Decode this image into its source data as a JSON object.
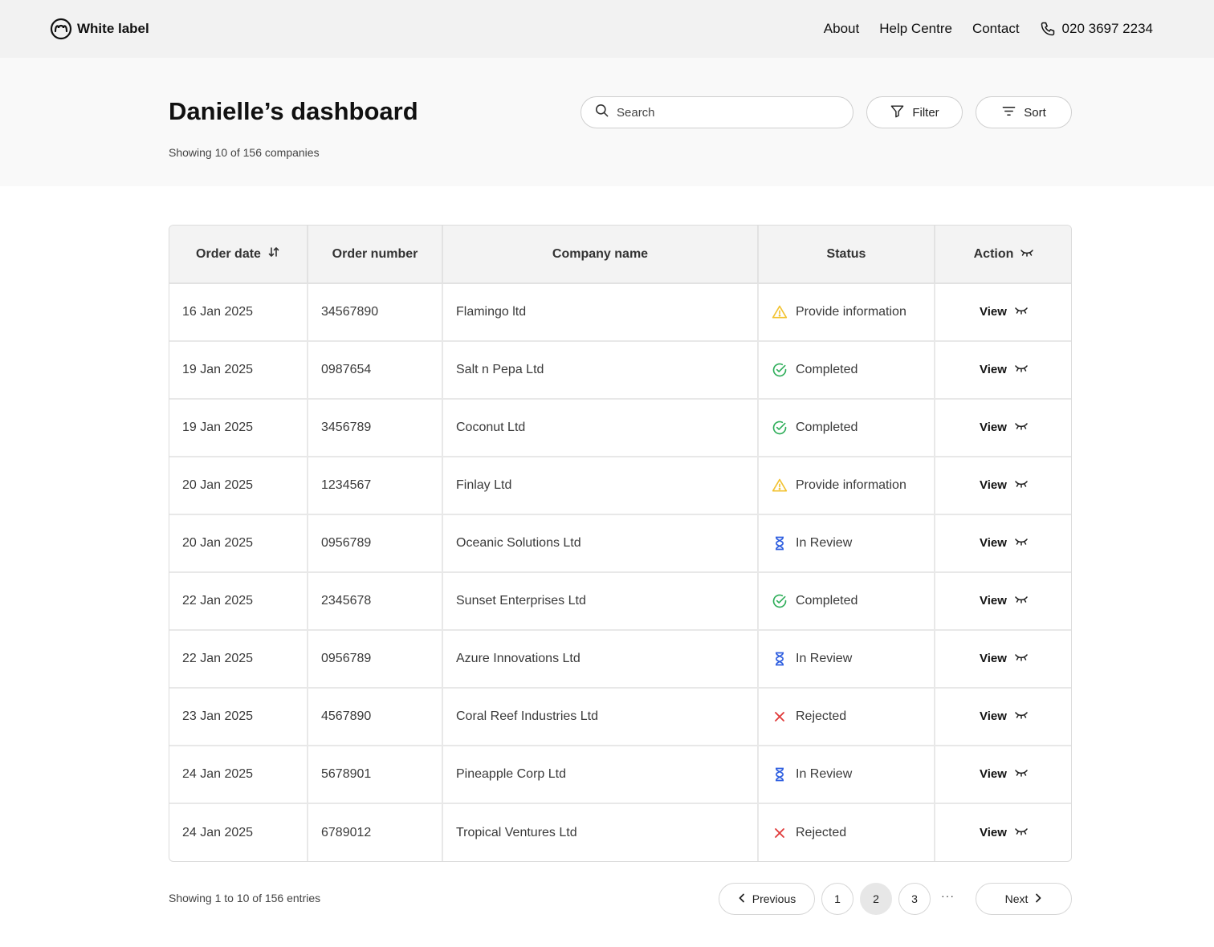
{
  "header": {
    "brand": "White label",
    "nav": [
      "About",
      "Help Centre",
      "Contact"
    ],
    "phone": "020 3697 2234"
  },
  "hero": {
    "title": "Danielle’s dashboard",
    "subtitle": "Showing 10 of 156 companies",
    "search_placeholder": "Search",
    "filter_label": "Filter",
    "sort_label": "Sort"
  },
  "table": {
    "columns": [
      "Order date",
      "Order number",
      "Company name",
      "Status",
      "Action"
    ],
    "view_label": "View",
    "rows": [
      {
        "date": "16 Jan 2025",
        "number": "34567890",
        "company": "Flamingo ltd",
        "status": "Provide information",
        "status_icon": "warning-icon"
      },
      {
        "date": "19 Jan 2025",
        "number": "0987654",
        "company": "Salt n Pepa Ltd",
        "status": "Completed",
        "status_icon": "check-circle-icon"
      },
      {
        "date": "19 Jan 2025",
        "number": "3456789",
        "company": "Coconut Ltd",
        "status": "Completed",
        "status_icon": "check-circle-icon"
      },
      {
        "date": "20 Jan 2025",
        "number": "1234567",
        "company": "Finlay Ltd",
        "status": "Provide information",
        "status_icon": "warning-icon"
      },
      {
        "date": "20 Jan 2025",
        "number": "0956789",
        "company": "Oceanic Solutions Ltd",
        "status": "In Review",
        "status_icon": "hourglass-icon"
      },
      {
        "date": "22 Jan 2025",
        "number": "2345678",
        "company": "Sunset Enterprises Ltd",
        "status": "Completed",
        "status_icon": "check-circle-icon"
      },
      {
        "date": "22 Jan 2025",
        "number": "0956789",
        "company": "Azure Innovations Ltd",
        "status": "In Review",
        "status_icon": "hourglass-icon"
      },
      {
        "date": "23 Jan 2025",
        "number": "4567890",
        "company": "Coral Reef Industries Ltd",
        "status": "Rejected",
        "status_icon": "x-icon"
      },
      {
        "date": "24 Jan 2025",
        "number": "5678901",
        "company": "Pineapple Corp Ltd",
        "status": "In Review",
        "status_icon": "hourglass-icon"
      },
      {
        "date": "24 Jan 2025",
        "number": "6789012",
        "company": "Tropical Ventures Ltd",
        "status": "Rejected",
        "status_icon": "x-icon"
      }
    ]
  },
  "pagination": {
    "summary": "Showing 1 to 10 of 156 entries",
    "previous": "Previous",
    "next": "Next",
    "pages": [
      "1",
      "2",
      "3"
    ],
    "current_page": "2",
    "ellipsis": "···"
  },
  "colors": {
    "warning": "#F2C230",
    "completed": "#2FAE5A",
    "in_review": "#2F5FE0",
    "rejected": "#E03A3A"
  }
}
